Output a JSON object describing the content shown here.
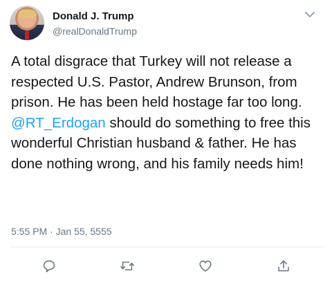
{
  "author": {
    "name": "Donald J. Trump",
    "handle": "@realDonaldTrump"
  },
  "tweet": {
    "text_before": "A total disgrace that Turkey will not release a respected U.S. Pastor, Andrew Brunson, from prison. He has been held hostage far too long. ",
    "mention": "@RT_Erdogan",
    "text_after": " should do something to free this wonderful Christian husband & father. He has done nothing wrong, and his family needs him!",
    "timestamp": "5:55 PM · Jan 55, 5555"
  },
  "icons": {
    "menu": "chevron-down-icon",
    "reply": "reply-icon",
    "retweet": "retweet-icon",
    "like": "heart-icon",
    "share": "share-icon"
  },
  "colors": {
    "text": "#14171a",
    "secondary": "#657786",
    "link": "#1da1f2",
    "divider": "#e1e8ed"
  }
}
